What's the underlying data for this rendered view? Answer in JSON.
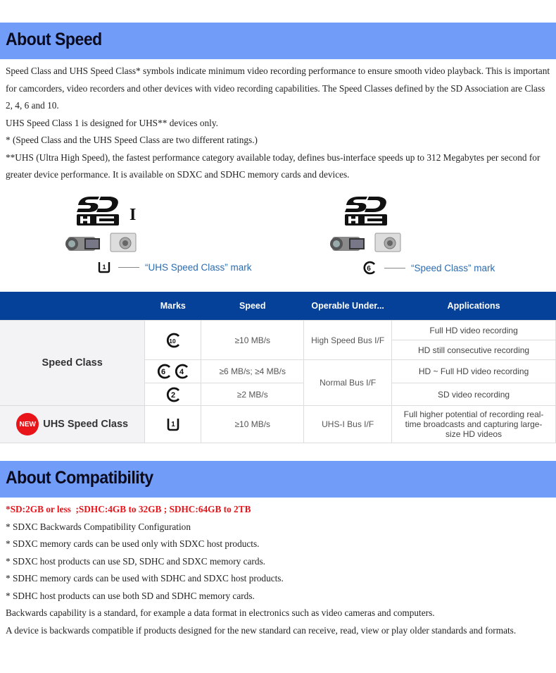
{
  "speed_section": {
    "title": "About Speed",
    "paragraphs": [
      "Speed Class and UHS Speed Class* symbols indicate minimum video recording performance to ensure smooth video playback. This is important for camcorders, video recorders and other devices with video recording capabilities. The Speed Classes defined by the SD Association are Class 2, 4, 6 and 10.",
      "UHS Speed Class 1 is designed for UHS** devices only.",
      "* (Speed Class and the UHS Speed Class are two different ratings.)",
      "**UHS (Ultra High Speed), the fastest performance category available today, defines bus-interface speeds up to 312 Megabytes per second for greater device performance. It is available on SDXC and SDHC memory cards and devices."
    ]
  },
  "illustrations": [
    {
      "logo": "SDHC I",
      "uhs_suffix": "I",
      "mark_symbol": "U1",
      "caption": "“UHS Speed Class” mark"
    },
    {
      "logo": "SDHC",
      "uhs_suffix": "",
      "mark_symbol": "C6",
      "caption": "“Speed Class” mark"
    }
  ],
  "table": {
    "headers": [
      "",
      "Marks",
      "Speed",
      "Operable Under...",
      "Applications"
    ],
    "groups": [
      {
        "label": "Speed Class",
        "new_badge": false,
        "rows": [
          {
            "marks": [
              "10"
            ],
            "speed": "≥10 MB/s",
            "operable": "High Speed Bus I/F",
            "applications": [
              "Full HD video recording",
              "HD still consecutive recording"
            ]
          },
          {
            "marks": [
              "6",
              "4"
            ],
            "speed": "≥6 MB/s; ≥4 MB/s",
            "operable": "Normal Bus I/F",
            "applications": [
              "HD ~ Full HD video recording"
            ]
          },
          {
            "marks": [
              "2"
            ],
            "speed": "≥2 MB/s",
            "operable": "",
            "applications": [
              "SD video recording"
            ]
          }
        ]
      },
      {
        "label": "UHS Speed Class",
        "new_badge": true,
        "badge_text": "NEW",
        "rows": [
          {
            "marks": [
              "U1"
            ],
            "speed": "≥10 MB/s",
            "operable": "UHS-I Bus I/F",
            "applications": [
              "Full higher potential of recording real-time broadcasts and capturing large-size HD videos"
            ]
          }
        ]
      }
    ]
  },
  "compat_section": {
    "title": "About Compatibility",
    "highlight": "*SD:2GB or less  ;SDHC:4GB to 32GB ; SDHC:64GB to 2TB",
    "lines": [
      "* SDXC Backwards Compatibility Configuration",
      "* SDXC memory cards can be used only with SDXC host products.",
      "* SDXC host products can use SD, SDHC and SDXC memory cards.",
      "* SDHC memory cards can be used with SDHC and SDXC host products.",
      "* SDHC host products can use both SD and SDHC memory cards.",
      "Backwards capability is a standard, for example a data format in electronics such as video cameras and computers.",
      "A device is backwards compatible if products designed for the new standard can receive, read, view or play older standards and formats."
    ]
  },
  "colors": {
    "banner": "#719cf7",
    "table_header": "#054099",
    "caption": "#2b6cb0",
    "highlight": "#e8141a"
  }
}
